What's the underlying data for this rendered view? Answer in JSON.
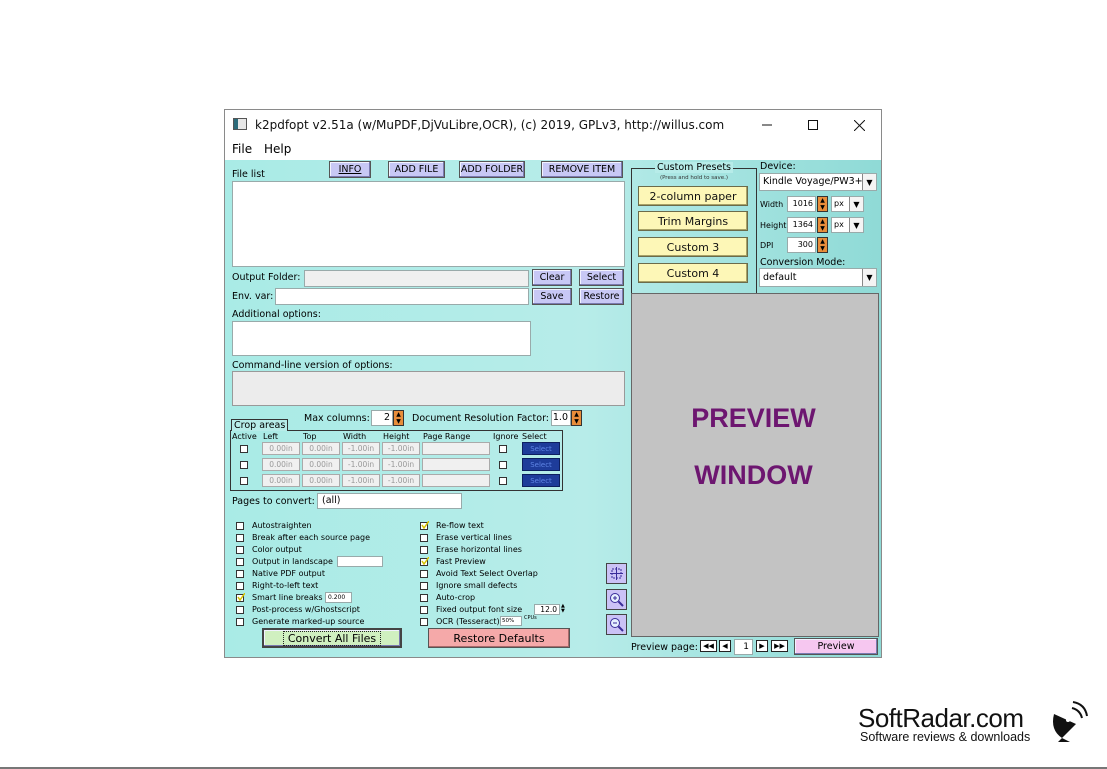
{
  "window": {
    "title": "k2pdfopt v2.51a (w/MuPDF,DjVuLibre,OCR), (c) 2019, GPLv3, http://willus.com"
  },
  "menu": [
    "File",
    "Help"
  ],
  "file_buttons": [
    "INFO",
    "ADD FILE",
    "ADD FOLDER",
    "REMOVE ITEM"
  ],
  "file_list_label": "File list",
  "output_folder": {
    "label": "Output Folder:",
    "value": "",
    "btn1": "Clear",
    "btn2": "Select"
  },
  "env_var": {
    "label": "Env. var:",
    "value": "",
    "btn1": "Save",
    "btn2": "Restore"
  },
  "additional_options_label": "Additional options:",
  "cmdline_label": "Command-line version of options:",
  "max_columns": {
    "label": "Max columns:",
    "value": "2"
  },
  "doc_res": {
    "label": "Document Resolution Factor:",
    "value": "1.0"
  },
  "crop": {
    "title": "Crop areas",
    "headers": [
      "Active",
      "Left",
      "Top",
      "Width",
      "Height",
      "Page Range",
      "Ignore",
      "Select"
    ],
    "rows": [
      {
        "left": "0.00in",
        "top": "0.00in",
        "width": "-1.00in",
        "height": "-1.00in",
        "select": "Select"
      },
      {
        "left": "0.00in",
        "top": "0.00in",
        "width": "-1.00in",
        "height": "-1.00in",
        "select": "Select"
      },
      {
        "left": "0.00in",
        "top": "0.00in",
        "width": "-1.00in",
        "height": "-1.00in",
        "select": "Select"
      }
    ]
  },
  "pages": {
    "label": "Pages to convert:",
    "value": "(all)"
  },
  "options_left": [
    {
      "label": "Autostraighten",
      "checked": false
    },
    {
      "label": "Break after each source page",
      "checked": false
    },
    {
      "label": "Color output",
      "checked": false
    },
    {
      "label": "Output in landscape",
      "checked": false
    },
    {
      "label": "Native PDF output",
      "checked": false
    },
    {
      "label": "Right-to-left text",
      "checked": false
    },
    {
      "label": "Smart line breaks",
      "checked": true,
      "value": "0.200"
    },
    {
      "label": "Post-process w/Ghostscript",
      "checked": false
    },
    {
      "label": "Generate marked-up source",
      "checked": false
    }
  ],
  "options_right": [
    {
      "label": "Re-flow text",
      "checked": true
    },
    {
      "label": "Erase vertical lines",
      "checked": false
    },
    {
      "label": "Erase horizontal lines",
      "checked": false
    },
    {
      "label": "Fast Preview",
      "checked": true
    },
    {
      "label": "Avoid Text Select Overlap",
      "checked": false
    },
    {
      "label": "Ignore small defects",
      "checked": false
    },
    {
      "label": "Auto-crop",
      "checked": false
    },
    {
      "label": "Fixed output font size",
      "checked": false,
      "value": "12.0"
    },
    {
      "label": "OCR (Tesseract)",
      "checked": false,
      "value": "50%",
      "suffix": "CPUs"
    }
  ],
  "convert_button": "Convert All Files",
  "restore_defaults": "Restore Defaults",
  "presets": {
    "title": "Custom Presets",
    "subtitle": "(Press and hold to save.)",
    "items": [
      "2-column paper",
      "Trim Margins",
      "Custom 3",
      "Custom 4"
    ]
  },
  "device": {
    "label": "Device:",
    "value": "Kindle Voyage/PW3+",
    "width_label": "Width",
    "width_value": "1016",
    "width_unit": "px",
    "height_label": "Height",
    "height_value": "1364",
    "height_unit": "px",
    "dpi_label": "DPI",
    "dpi_value": "300",
    "mode_label": "Conversion Mode:",
    "mode_value": "default"
  },
  "preview": {
    "line1": "PREVIEW",
    "line2": "WINDOW",
    "page_label": "Preview page:",
    "page_value": "1",
    "button": "Preview"
  },
  "watermark": {
    "brand": "SoftRadar.com",
    "tagline": "Software reviews & downloads"
  },
  "colors": {
    "accent_purple": "#6d1670",
    "teal_bg": "#a9ebe6",
    "preset_yellow": "#fdf7b7",
    "button_lilac": "#c8c8f5"
  }
}
